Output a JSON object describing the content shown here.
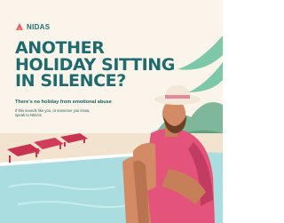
{
  "brand": {
    "name": "NIDAS",
    "logo_icon": "nidas-logo-icon"
  },
  "headline": {
    "line1": "ANOTHER",
    "line2": "HOLIDAY SITTING",
    "line3": "IN SILENCE?"
  },
  "subheading": "There's no holiday from emotional abuse",
  "body": "If this sounds like you, or someone you know, speak to NIDAS",
  "colors": {
    "headline": "#1d6b6e",
    "background": "#fbf4ea",
    "pool": "#a9dde0",
    "shirt": "#e4547a",
    "hat": "#f3e7d6",
    "hat_band": "#e28a9c"
  }
}
